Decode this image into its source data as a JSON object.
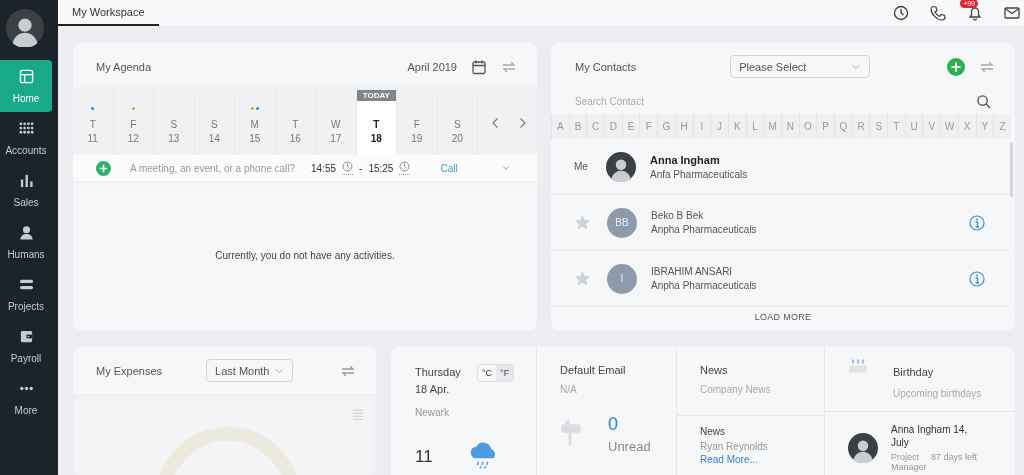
{
  "sidebar": {
    "items": [
      {
        "label": "Home",
        "selected": true
      },
      {
        "label": "Accounts",
        "selected": false
      },
      {
        "label": "Sales",
        "selected": false
      },
      {
        "label": "Humans",
        "selected": false
      },
      {
        "label": "Projects",
        "selected": false
      },
      {
        "label": "Payroll",
        "selected": false
      },
      {
        "label": "More",
        "selected": false
      }
    ]
  },
  "topbar": {
    "tabs": [
      {
        "label": "My Workspace",
        "selected": true
      }
    ],
    "notification_badge": "+99"
  },
  "agenda": {
    "title": "My Agenda",
    "month": "April 2019",
    "today_label": "TODAY",
    "days": [
      {
        "weekday": "T",
        "date": "11",
        "today": false,
        "dots": [
          {
            "color": "#2b8fd6"
          }
        ]
      },
      {
        "weekday": "F",
        "date": "12",
        "today": false,
        "dots": [
          {
            "color": "#e0a040"
          }
        ]
      },
      {
        "weekday": "S",
        "date": "13",
        "today": false
      },
      {
        "weekday": "S",
        "date": "14",
        "today": false
      },
      {
        "weekday": "M",
        "date": "15",
        "today": false,
        "dots": [
          {
            "color": "#e0a040"
          },
          {
            "color": "#2b8fd6"
          }
        ]
      },
      {
        "weekday": "T",
        "date": "16",
        "today": false
      },
      {
        "weekday": "W",
        "date": "17",
        "today": false
      },
      {
        "weekday": "T",
        "date": "18",
        "today": true
      },
      {
        "weekday": "F",
        "date": "19",
        "today": false
      },
      {
        "weekday": "S",
        "date": "20",
        "today": false
      }
    ],
    "new_activity": {
      "placeholder": "A meeting, an event, or a phone call?",
      "start": "14:55",
      "separator": "-",
      "end": "15:25",
      "type": "Call"
    },
    "empty_message": "Currently, you do not have any activities."
  },
  "contacts": {
    "title": "My Contacts",
    "filter": "Please Select",
    "search_placeholder": "Search Contact",
    "letters": [
      "A",
      "B",
      "C",
      "D",
      "E",
      "F",
      "G",
      "H",
      "I",
      "J",
      "K",
      "L",
      "M",
      "N",
      "O",
      "P",
      "Q",
      "R",
      "S",
      "T",
      "U",
      "V",
      "W",
      "X",
      "Y",
      "Z"
    ],
    "me": {
      "label": "Me",
      "name": "Anna Ingham",
      "company": "Anfa Pharmaceuticals"
    },
    "items": [
      {
        "initials": "BB",
        "name": "Beko B Bek",
        "company": "Anpha Pharmaceuticals",
        "starred": false
      },
      {
        "initials": "I",
        "name": "IBRAHIM ANSARI",
        "company": "Anpha Pharmaceuticals",
        "starred": false
      }
    ],
    "load_more": "LOAD MORE"
  },
  "expenses": {
    "title": "My Expenses",
    "period": "Last Month"
  },
  "weather": {
    "date": "Thursday 18 Apr.",
    "units": [
      {
        "label": "°C",
        "selected": false
      },
      {
        "label": "°F",
        "selected": true
      }
    ],
    "city": "Newark",
    "temperature": "11"
  },
  "email": {
    "title": "Default Email",
    "address": "N/A",
    "count": "0",
    "count_label": "Unread"
  },
  "news": {
    "title": "News",
    "subtitle": "Company News",
    "item": {
      "title": "News",
      "author": "Ryan Reynolds",
      "link": "Read More..."
    }
  },
  "birthday": {
    "title": "Birthday",
    "subtitle": "Upcoming birthdays",
    "person": {
      "name": "Anna Ingham",
      "date": "14, July",
      "role": "Project Manager",
      "days_left": "87 days left"
    }
  }
}
